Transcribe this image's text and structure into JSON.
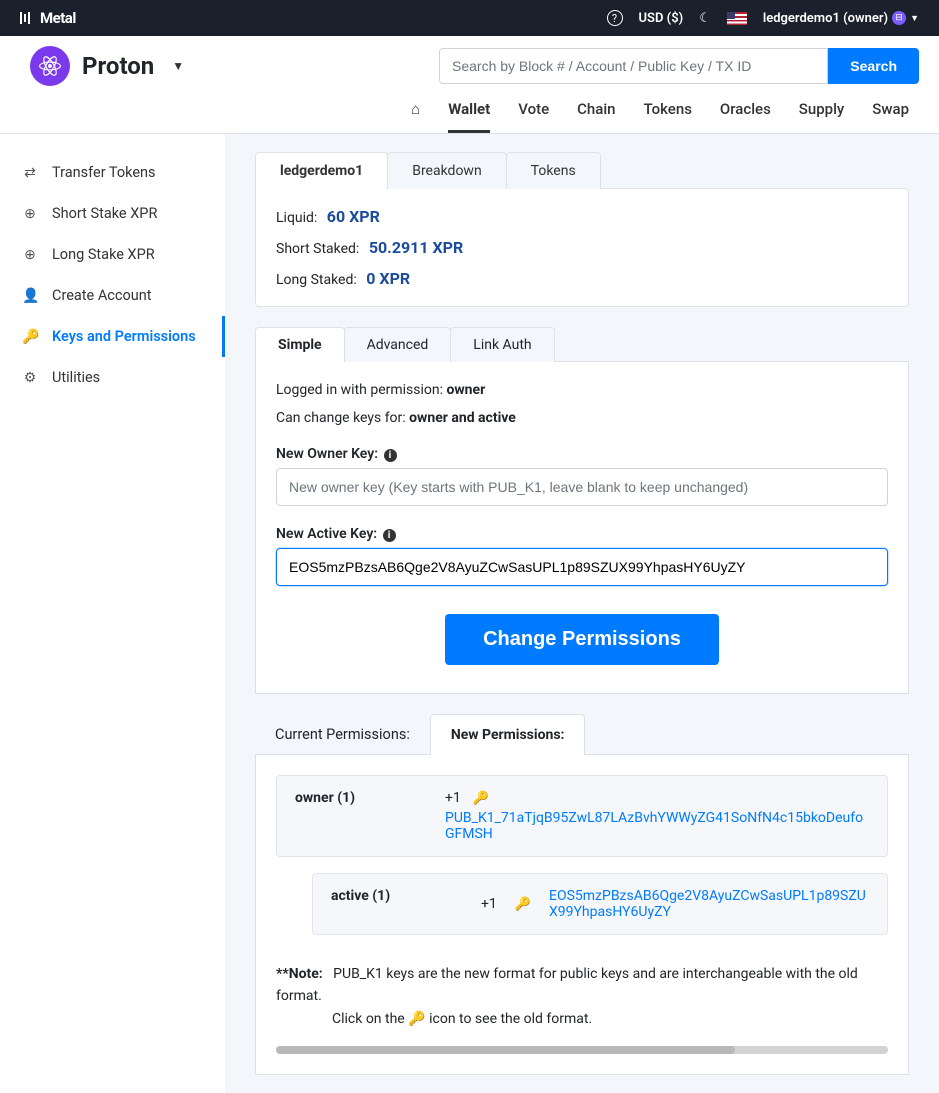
{
  "topbar": {
    "brand": "Metal",
    "currency": "USD ($)",
    "user": "ledgerdemo1 (owner)"
  },
  "header": {
    "chain_name": "Proton",
    "search_placeholder": "Search by Block # / Account / Public Key / TX ID",
    "search_btn": "Search"
  },
  "nav": {
    "wallet": "Wallet",
    "vote": "Vote",
    "chain": "Chain",
    "tokens": "Tokens",
    "oracles": "Oracles",
    "supply": "Supply",
    "swap": "Swap"
  },
  "sidebar": {
    "transfer": "Transfer Tokens",
    "short_stake": "Short Stake XPR",
    "long_stake": "Long Stake XPR",
    "create_account": "Create Account",
    "keys_perms": "Keys and Permissions",
    "utilities": "Utilities"
  },
  "account_tabs": {
    "name": "ledgerdemo1",
    "breakdown": "Breakdown",
    "tokens": "Tokens"
  },
  "balances": {
    "liquid_label": "Liquid:",
    "liquid_value": "60 XPR",
    "short_label": "Short Staked:",
    "short_value": "50.2911 XPR",
    "long_label": "Long Staked:",
    "long_value": "0 XPR"
  },
  "perm_tabs": {
    "simple": "Simple",
    "advanced": "Advanced",
    "link_auth": "Link Auth"
  },
  "perm_form": {
    "logged_in_prefix": "Logged in with permission: ",
    "logged_in_perm": "owner",
    "can_change_prefix": "Can change keys for: ",
    "can_change_perms": "owner and active",
    "owner_label": "New Owner Key: ",
    "owner_placeholder": "New owner key (Key starts with PUB_K1, leave blank to keep unchanged)",
    "active_label": "New Active Key: ",
    "active_value": "EOS5mzPBzsAB6Qge2V8AyuZCwSasUPL1p89SZUX99YhpasHY6UyZY",
    "change_btn": "Change Permissions"
  },
  "permissions_section": {
    "current_label": "Current Permissions:",
    "new_label": "New Permissions:",
    "owner_name": "owner (1)",
    "owner_weight": "+1",
    "owner_key": "PUB_K1_71aTjqB95ZwL87LAzBvhYWWyZG41SoNfN4c15bkoDeufoGFMSH",
    "active_name": "active (1)",
    "active_weight": "+1",
    "active_key": "EOS5mzPBzsAB6Qge2V8AyuZCwSasUPL1p89SZUX99YhpasHY6UyZY"
  },
  "note": {
    "prefix": "**Note:",
    "line1": "PUB_K1 keys are the new format for public keys and are interchangeable with the old format.",
    "line2_a": "Click on the ",
    "line2_b": " icon to see the old format."
  }
}
